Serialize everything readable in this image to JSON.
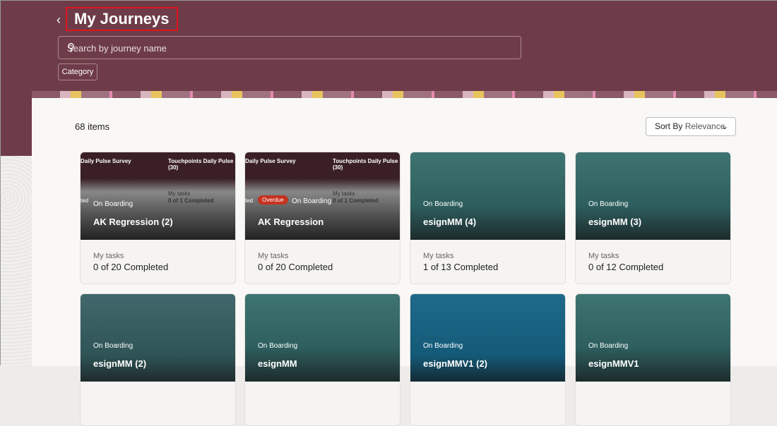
{
  "header": {
    "title": "My Journeys",
    "search_placeholder": "Search by journey name",
    "category_label": "Category"
  },
  "toolbar": {
    "count": "68 items",
    "sort_prefix": "Sort By",
    "sort_value": "Relevance"
  },
  "cards": [
    {
      "category": "On Boarding",
      "name": "AK Regression (2)",
      "tasks_label": "My tasks",
      "progress": "0 of 20 Completed",
      "bg_left": "Daily Pulse Survey",
      "bg_right": "Touchpoints Daily Pulse (30)",
      "bg_tasks": "My tasks",
      "bg_progress": "0 of 1 Completed",
      "bg_frag": "ted"
    },
    {
      "category": "On Boarding",
      "name": "AK Regression",
      "badge": "Overdue",
      "tasks_label": "My tasks",
      "progress": "0 of 20 Completed",
      "bg_left": "Daily Pulse Survey",
      "bg_right": "Touchpoints Daily Pulse (30)",
      "bg_tasks": "My tasks",
      "bg_progress": "0 of 1 Completed",
      "bg_frag": "ted"
    },
    {
      "category": "On Boarding",
      "name": "esignMM (4)",
      "tasks_label": "My tasks",
      "progress": "1 of 13 Completed"
    },
    {
      "category": "On Boarding",
      "name": "esignMM (3)",
      "tasks_label": "My tasks",
      "progress": "0 of 12 Completed"
    },
    {
      "category": "On Boarding",
      "name": "esignMM (2)"
    },
    {
      "category": "On Boarding",
      "name": "esignMM"
    },
    {
      "category": "On Boarding",
      "name": "esignMMV1 (2)"
    },
    {
      "category": "On Boarding",
      "name": "esignMMV1"
    }
  ]
}
